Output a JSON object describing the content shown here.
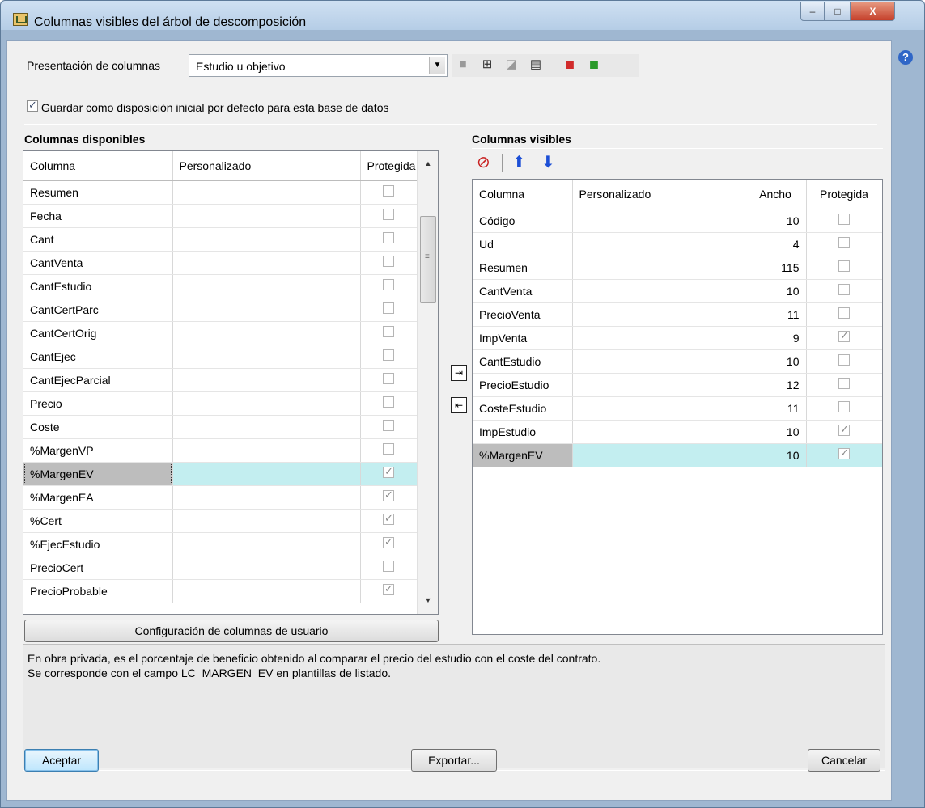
{
  "window": {
    "title": "Columnas visibles del árbol de descomposición",
    "controls": {
      "min": "–",
      "max": "□",
      "close": "X"
    }
  },
  "presentation": {
    "label": "Presentación de columnas",
    "selected": "Estudio u objetivo"
  },
  "toolbar": {
    "icons": [
      "save-icon",
      "add-icon",
      "edit-icon",
      "print-icon",
      "import-icon",
      "export-icon"
    ]
  },
  "default_checkbox": {
    "label": "Guardar como disposición inicial por defecto para esta base de datos",
    "checked": true
  },
  "available": {
    "title": "Columnas disponibles",
    "headers": [
      "Columna",
      "Personalizado",
      "Protegida"
    ],
    "rows": [
      {
        "name": "Resumen",
        "custom": "",
        "protected": false
      },
      {
        "name": "Fecha",
        "custom": "",
        "protected": false
      },
      {
        "name": "Cant",
        "custom": "",
        "protected": false
      },
      {
        "name": "CantVenta",
        "custom": "",
        "protected": false
      },
      {
        "name": "CantEstudio",
        "custom": "",
        "protected": false
      },
      {
        "name": "CantCertParc",
        "custom": "",
        "protected": false
      },
      {
        "name": "CantCertOrig",
        "custom": "",
        "protected": false
      },
      {
        "name": "CantEjec",
        "custom": "",
        "protected": false
      },
      {
        "name": "CantEjecParcial",
        "custom": "",
        "protected": false
      },
      {
        "name": "Precio",
        "custom": "",
        "protected": false
      },
      {
        "name": "Coste",
        "custom": "",
        "protected": false
      },
      {
        "name": "%MargenVP",
        "custom": "",
        "protected": false
      },
      {
        "name": "%MargenEV",
        "custom": "",
        "protected": true
      },
      {
        "name": "%MargenEA",
        "custom": "",
        "protected": true
      },
      {
        "name": "%Cert",
        "custom": "",
        "protected": true
      },
      {
        "name": "%EjecEstudio",
        "custom": "",
        "protected": true
      },
      {
        "name": "PrecioCert",
        "custom": "",
        "protected": false
      },
      {
        "name": "PrecioProbable",
        "custom": "",
        "protected": true
      }
    ],
    "config_button": "Configuración de columnas de usuario"
  },
  "visible": {
    "title": "Columnas visibles",
    "headers": [
      "Columna",
      "Personalizado",
      "Ancho",
      "Protegida"
    ],
    "rows": [
      {
        "name": "Código",
        "custom": "",
        "width": "10",
        "protected": false
      },
      {
        "name": "Ud",
        "custom": "",
        "width": "4",
        "protected": false
      },
      {
        "name": "Resumen",
        "custom": "",
        "width": "115",
        "protected": false
      },
      {
        "name": "CantVenta",
        "custom": "",
        "width": "10",
        "protected": false
      },
      {
        "name": "PrecioVenta",
        "custom": "",
        "width": "11",
        "protected": false
      },
      {
        "name": "ImpVenta",
        "custom": "",
        "width": "9",
        "protected": true
      },
      {
        "name": "CantEstudio",
        "custom": "",
        "width": "10",
        "protected": false
      },
      {
        "name": "PrecioEstudio",
        "custom": "",
        "width": "12",
        "protected": false
      },
      {
        "name": "CosteEstudio",
        "custom": "",
        "width": "11",
        "protected": false
      },
      {
        "name": "ImpEstudio",
        "custom": "",
        "width": "10",
        "protected": true
      },
      {
        "name": "%MargenEV",
        "custom": "",
        "width": "10",
        "protected": true
      }
    ]
  },
  "description": {
    "line1": "En obra privada, es el porcentaje de beneficio obtenido al comparar el precio del estudio con el coste del contrato.",
    "line2": "Se corresponde con el campo LC_MARGEN_EV en plantillas de listado."
  },
  "buttons": {
    "accept": "Aceptar",
    "export": "Exportar...",
    "cancel": "Cancelar"
  },
  "selected_available_row": 12,
  "selected_visible_row": 10
}
